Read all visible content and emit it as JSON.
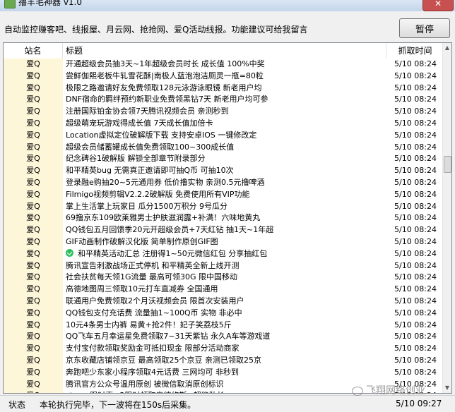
{
  "window": {
    "title": "撸羊毛神器 v1.0",
    "close_label": "✕"
  },
  "toolbar": {
    "status": "自动监控赚客吧、线报屋、月云网、抢抢网、爱Q活动线报。功能建议可给我留言",
    "pause_label": "暂停"
  },
  "list": {
    "columns": {
      "site": "站名",
      "title": "标题",
      "time": "抓取时间"
    },
    "rows": [
      {
        "site": "爱Q",
        "title": "开通超级会员抽3天~1年超级会员时长 成长值 100%中奖",
        "time": "5/10 08:24"
      },
      {
        "site": "爱Q",
        "title": "尝鲜伽熙老板牛轧雪花酥|南极人蓝泡泡洁厕灵一瓶=80粒",
        "time": "5/10 08:24"
      },
      {
        "site": "爱Q",
        "title": "极限之路邀请好友免费领取128元泳游泳眼镜 新老用户均",
        "time": "5/10 08:24"
      },
      {
        "site": "爱Q",
        "title": "DNF宿命的羁绊预约新职业免费领黑钻7天 新老用户均可参",
        "time": "5/10 08:24"
      },
      {
        "site": "爱Q",
        "title": "注册国际铂金协会领7天腾讯视频会员 亲测秒到",
        "time": "5/10 08:24"
      },
      {
        "site": "爱Q",
        "title": "超级萌宠玩游戏得成长值 7天成长值加倍卡",
        "time": "5/10 08:24"
      },
      {
        "site": "爱Q",
        "title": "Location虚拟定位破解版下载 支持安卓IOS 一键修改定",
        "time": "5/10 08:24"
      },
      {
        "site": "爱Q",
        "title": "超级会员储蓄罐成长值免费领取100~300成长值",
        "time": "5/10 08:24"
      },
      {
        "site": "爱Q",
        "title": "纪念碑谷1破解版 解锁全部章节附录部分",
        "time": "5/10 08:24"
      },
      {
        "site": "爱Q",
        "title": "和平精英bug 无需真正邀请即可抽Q币 可抽10次",
        "time": "5/10 08:24"
      },
      {
        "site": "爱Q",
        "title": "登录融e购抽20~5元通用券 低价撸实物 亲测0.5元撸啤酒",
        "time": "5/10 08:24"
      },
      {
        "site": "爱Q",
        "title": "Filmigo视频剪辑V2.2.2破解版 免费使用所有VIP功能",
        "time": "5/10 08:24"
      },
      {
        "site": "爱Q",
        "title": "掌上生活掌上玩家日 瓜分1500万积分 9号瓜分",
        "time": "5/10 08:24"
      },
      {
        "site": "爱Q",
        "title": "69撸京东109欧莱雅男士护肤滋润露+补满！六味地黄丸",
        "time": "5/10 08:24"
      },
      {
        "site": "爱Q",
        "title": "QQ钱包五月回馈季20元开超级会员+7天红钻 抽1天~1年超",
        "time": "5/10 08:24"
      },
      {
        "site": "爱Q",
        "title": "GIF动画制作破解汉化版 简单制作原创GIF图",
        "time": "5/10 08:24"
      },
      {
        "site": "爱Q",
        "title": "和平精英活动汇总 注册得1~50元微信红包 分享抽红包",
        "time": "5/10 08:24",
        "icon": "wechat-icon"
      },
      {
        "site": "爱Q",
        "title": "腾讯宣告刺激战场正式停机 和平精英全新上线开测",
        "time": "5/10 08:24"
      },
      {
        "site": "爱Q",
        "title": "社会扶贫每天领1G流量 最高可领30G 限中国移动",
        "time": "5/10 08:24"
      },
      {
        "site": "爱Q",
        "title": "高德地图周三领取10元打车直减券 全国通用",
        "time": "5/10 08:24"
      },
      {
        "site": "爱Q",
        "title": "联通用户免费领取2个月沃视频会员 限首次安装用户",
        "time": "5/10 08:24"
      },
      {
        "site": "爱Q",
        "title": "QQ钱包支付充话费 流量抽1~100Q币 实物 非必中",
        "time": "5/10 08:24"
      },
      {
        "site": "爱Q",
        "title": "10元4条男士内裤 易黄+抢2件！妃子笑荔枝5斤",
        "time": "5/10 08:24"
      },
      {
        "site": "爱Q",
        "title": "QQ飞车五月幸运星免费领取7~31天紫钻 永久A车等游戏道",
        "time": "5/10 08:24"
      },
      {
        "site": "爱Q",
        "title": "支付宝付款领取奖励金可抵扣现金 限部分活动商家",
        "time": "5/10 08:24"
      },
      {
        "site": "爱Q",
        "title": "京东收藏店铺领京豆 最高领取25个京豆 亲测已领取25京",
        "time": "5/10 08:24"
      },
      {
        "site": "爱Q",
        "title": "奔跑吧少东家小程序领取4元话费 三网均可 非秒到",
        "time": "5/10 08:24"
      },
      {
        "site": "爱Q",
        "title": "腾讯官方公众号温用原创 被微信取消原创标识",
        "time": "5/10 08:24"
      },
      {
        "site": "爱Q",
        "title": "steam限时喜+2限时领取奥德修斯+超能队长",
        "time": "5/10 08:24"
      },
      {
        "site": "抢抢网",
        "title": "今天中国农业访谈调研",
        "time": "5/10 08:24"
      }
    ]
  },
  "statusbar": {
    "label": "状态",
    "message": "本轮执行完毕，下一波将在150s后采集。",
    "clock": "5/10 09:27"
  },
  "watermark": {
    "text": "飞翔网络创业"
  }
}
